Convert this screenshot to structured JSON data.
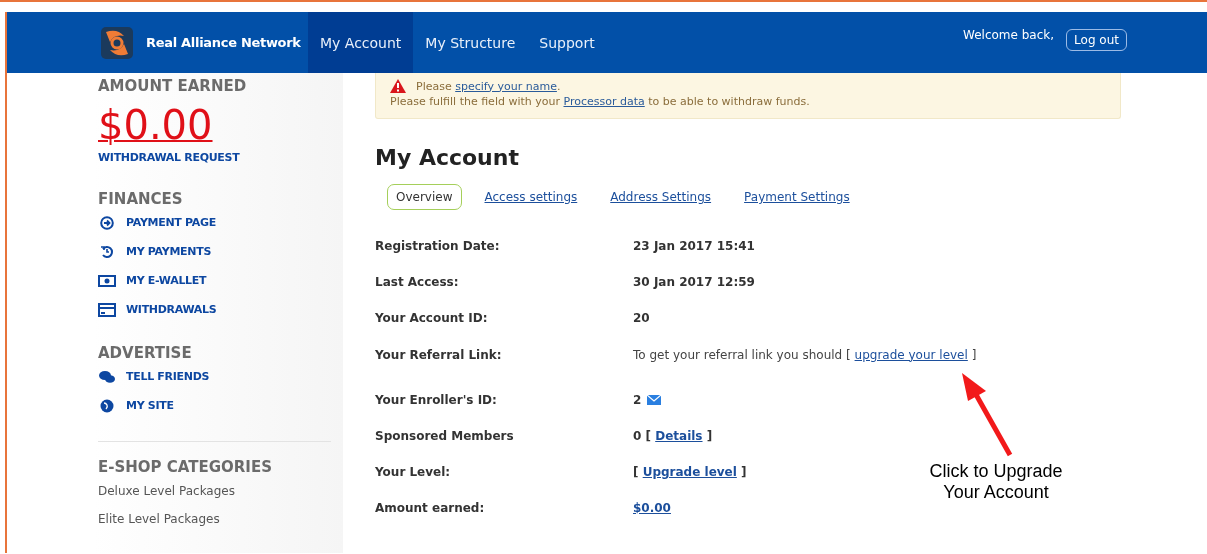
{
  "header": {
    "brand": "Real Alliance Network",
    "nav": [
      {
        "label": "My Account",
        "selected": true
      },
      {
        "label": "My Structure",
        "selected": false
      },
      {
        "label": "Support",
        "selected": false
      }
    ],
    "welcome": "Welcome back,",
    "logout": "Log out"
  },
  "sidebar": {
    "amount_title": "AMOUNT EARNED",
    "amount": "$0.00",
    "withdrawal": "WITHDRAWAL REQUEST",
    "sections": [
      {
        "title": "FINANCES",
        "items": [
          {
            "label": "PAYMENT PAGE",
            "kind": "arrow"
          },
          {
            "label": "MY PAYMENTS",
            "kind": "history"
          },
          {
            "label": "MY E-WALLET",
            "kind": "wallet"
          },
          {
            "label": "WITHDRAWALS",
            "kind": "card"
          }
        ]
      },
      {
        "title": "ADVERTISE",
        "items": [
          {
            "label": "TELL FRIENDS",
            "kind": "chat"
          },
          {
            "label": "MY SITE",
            "kind": "globe"
          }
        ]
      }
    ],
    "shop_title": "E-SHOP CATEGORIES",
    "shop_items": [
      "Deluxe Level Packages",
      "Elite Level Packages"
    ]
  },
  "alert": {
    "line1": [
      {
        "kind": "text",
        "text": "Please "
      },
      {
        "kind": "link",
        "text": "specify your name"
      },
      {
        "kind": "text",
        "text": "."
      }
    ],
    "line2": [
      {
        "kind": "text",
        "text": "Please fulfill the field with your "
      },
      {
        "kind": "link",
        "text": "Processor data"
      },
      {
        "kind": "text",
        "text": " to be able to withdraw funds."
      }
    ]
  },
  "title": "My Account",
  "tabs": [
    {
      "label": "Overview",
      "selected": true
    },
    {
      "label": "Access settings",
      "selected": false
    },
    {
      "label": "Address Settings",
      "selected": false
    },
    {
      "label": "Payment Settings",
      "selected": false
    }
  ],
  "rows": [
    {
      "label": "Registration Date:",
      "value": [
        {
          "kind": "strong",
          "text": "23 Jan 2017 15:41"
        }
      ]
    },
    {
      "label": "Last Access:",
      "value": [
        {
          "kind": "strong",
          "text": "30 Jan 2017 12:59"
        }
      ]
    },
    {
      "label": "Your Account ID:",
      "value": [
        {
          "kind": "strong",
          "text": "20"
        }
      ]
    },
    {
      "label": "Your Referral Link:",
      "value": [
        {
          "kind": "text",
          "text": "To get your referral link you should [ "
        },
        {
          "kind": "link",
          "text": "upgrade your level"
        },
        {
          "kind": "text",
          "text": " ]"
        }
      ]
    },
    {
      "label": "Your Enroller's ID:",
      "value": [
        {
          "kind": "strong",
          "text": "2"
        },
        {
          "kind": "mail"
        }
      ]
    },
    {
      "label": "Sponsored Members",
      "value": [
        {
          "kind": "strong",
          "text": "0 [ "
        },
        {
          "kind": "strong-link",
          "text": "Details"
        },
        {
          "kind": "strong",
          "text": " ]"
        }
      ]
    },
    {
      "label": "Your Level:",
      "value": [
        {
          "kind": "strong",
          "text": "[ "
        },
        {
          "kind": "strong-link",
          "text": "Upgrade level"
        },
        {
          "kind": "strong",
          "text": " ]"
        }
      ]
    },
    {
      "label": "Amount earned:",
      "value": [
        {
          "kind": "strong-link",
          "text": "$0.00"
        }
      ]
    }
  ],
  "annotation": "Click to Upgrade Your Account"
}
